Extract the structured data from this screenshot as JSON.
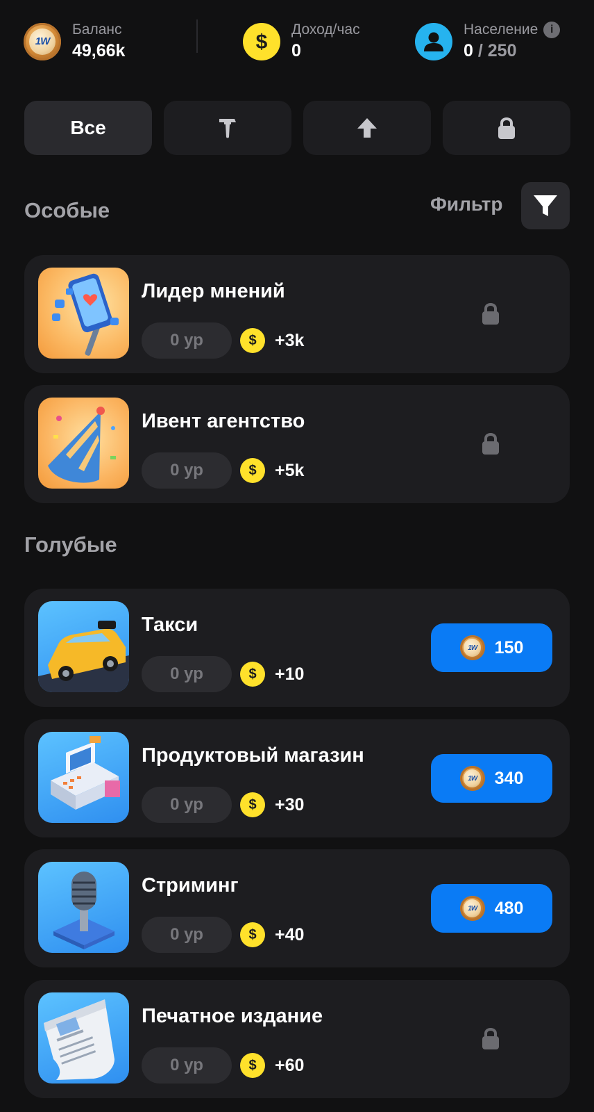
{
  "header": {
    "balance": {
      "label": "Баланс",
      "value": "49,66k",
      "icon": "1w-coin-icon"
    },
    "income": {
      "label": "Доход/час",
      "value": "0",
      "icon": "dollar-coin-icon"
    },
    "population": {
      "label": "Население",
      "current": "0",
      "separator": "/",
      "max": "250",
      "icon": "user-icon",
      "info_icon": "info-icon"
    }
  },
  "tabs": [
    {
      "label": "Все",
      "active": true
    },
    {
      "icon": "hammer-icon"
    },
    {
      "icon": "arrow-up-icon"
    },
    {
      "icon": "lock-icon"
    }
  ],
  "filter": {
    "label": "Фильтр",
    "icon": "funnel-icon"
  },
  "sections": [
    {
      "title": "Особые",
      "items": [
        {
          "name": "Лидер мнений",
          "level": "0 ур",
          "income": "+3k",
          "state": "locked",
          "image": "selfie-stick-phone"
        },
        {
          "name": "Ивент агентство",
          "level": "0 ур",
          "income": "+5k",
          "state": "locked",
          "image": "party-hat"
        }
      ]
    },
    {
      "title": "Голубые",
      "items": [
        {
          "name": "Такси",
          "level": "0 ур",
          "income": "+10",
          "state": "buy",
          "price": "150",
          "image": "taxi-car"
        },
        {
          "name": "Продуктовый магазин",
          "level": "0 ур",
          "income": "+30",
          "state": "buy",
          "price": "340",
          "image": "cash-register"
        },
        {
          "name": "Стриминг",
          "level": "0 ур",
          "income": "+40",
          "state": "buy",
          "price": "480",
          "image": "microphone"
        },
        {
          "name": "Печатное издание",
          "level": "0 ур",
          "income": "+60",
          "state": "locked",
          "image": "newspaper"
        }
      ]
    }
  ],
  "colors": {
    "background": "#111112",
    "card": "#1d1d20",
    "accent_blue": "#0a7bf5",
    "coin_yellow": "#ffe12b",
    "muted_text": "#9a9aa0"
  },
  "coin_labels": {
    "one_w": "1W",
    "dollar": "$"
  }
}
